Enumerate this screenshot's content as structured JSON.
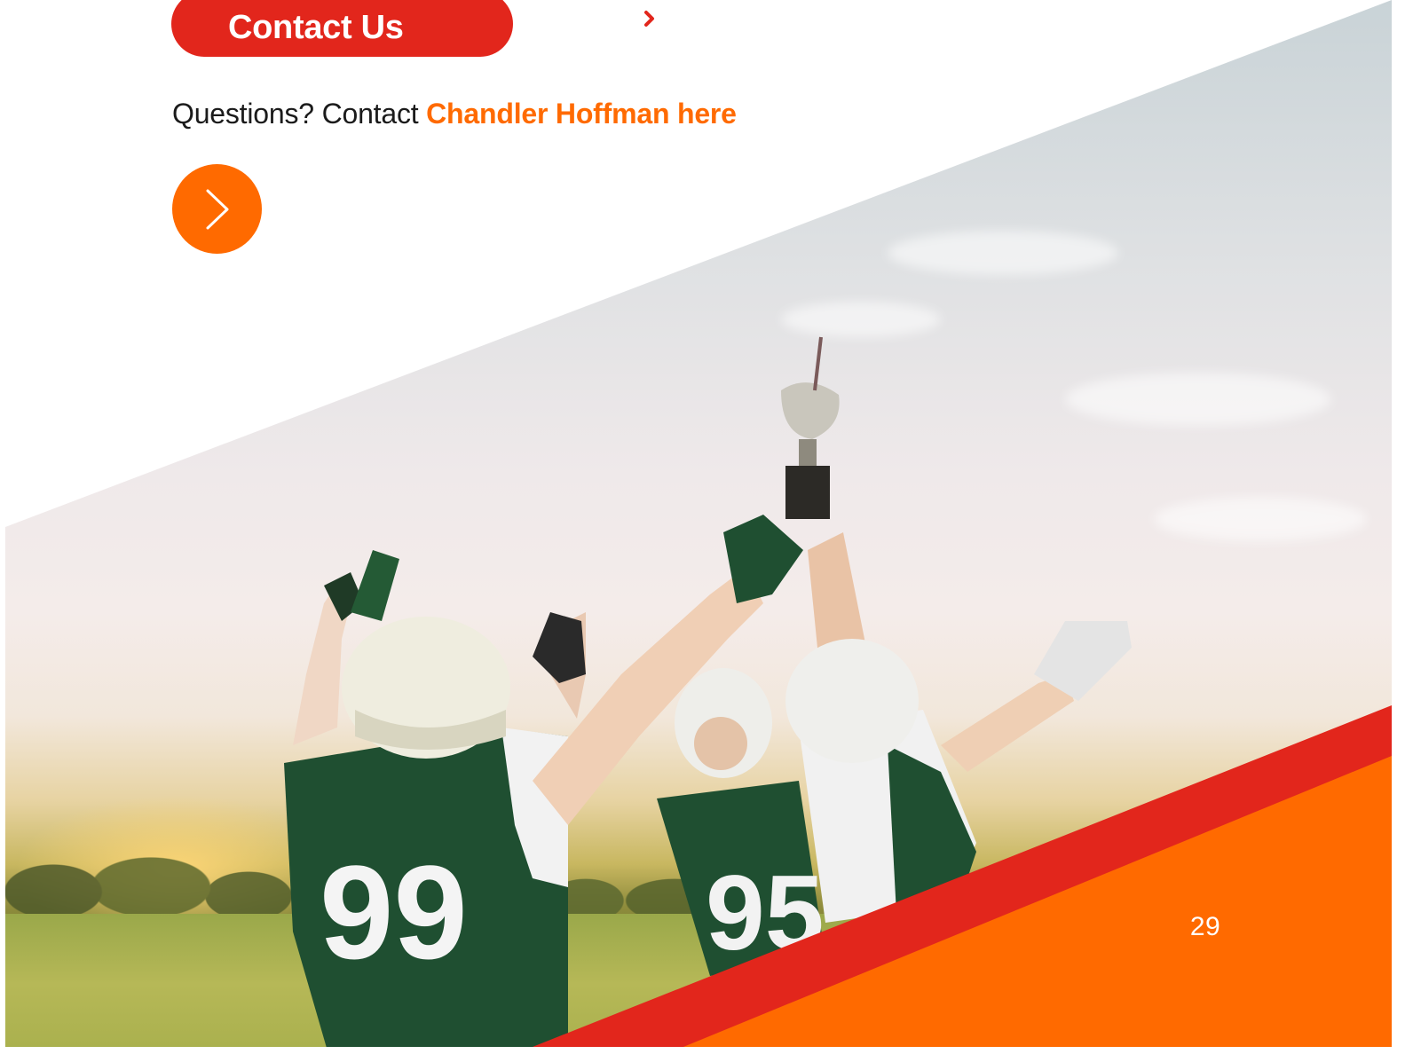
{
  "contact_button": {
    "label": "Contact Us",
    "icon": "chevron-right-circle-icon"
  },
  "questions": {
    "prefix": "Questions? Contact ",
    "link_text": "Chandler Hoffman here"
  },
  "next_button": {
    "icon": "chevron-right-icon"
  },
  "photo": {
    "subject": "football-team-celebrating-with-trophy",
    "jersey_numbers": [
      "99",
      "95"
    ]
  },
  "page_number": "29",
  "colors": {
    "brand_red": "#e2261c",
    "brand_orange": "#ff6a00",
    "text_dark": "#1b1b1b",
    "white": "#ffffff"
  }
}
